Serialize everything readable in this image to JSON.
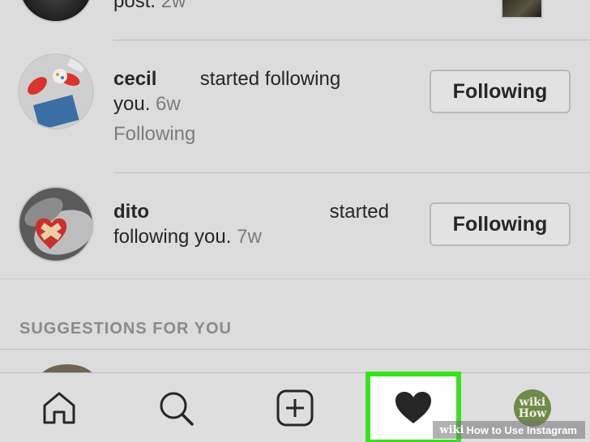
{
  "top_row": {
    "text": "post.",
    "age": "2w"
  },
  "notifications": [
    {
      "username": "cecil",
      "action_line1": "started following",
      "action_line2": "you.",
      "age": "6w",
      "status": "Following",
      "button_label": "Following"
    },
    {
      "username": "dito",
      "action_line1": "started",
      "action_line2": "following you.",
      "age": "7w",
      "button_label": "Following"
    }
  ],
  "suggestions": {
    "header": "SUGGESTIONS FOR YOU"
  },
  "bottom_nav": {
    "items": [
      {
        "name": "home",
        "icon": "home-icon"
      },
      {
        "name": "search",
        "icon": "search-icon"
      },
      {
        "name": "add",
        "icon": "add-post-icon"
      },
      {
        "name": "activity",
        "icon": "heart-icon",
        "highlighted": true,
        "highlight_color": "#39e21f"
      },
      {
        "name": "profile",
        "icon": "profile-avatar"
      }
    ],
    "profile_avatar_text_line1": "wiki",
    "profile_avatar_text_line2": "How"
  },
  "watermark": {
    "brand": "wiki",
    "title": "How to Use Instagram"
  }
}
